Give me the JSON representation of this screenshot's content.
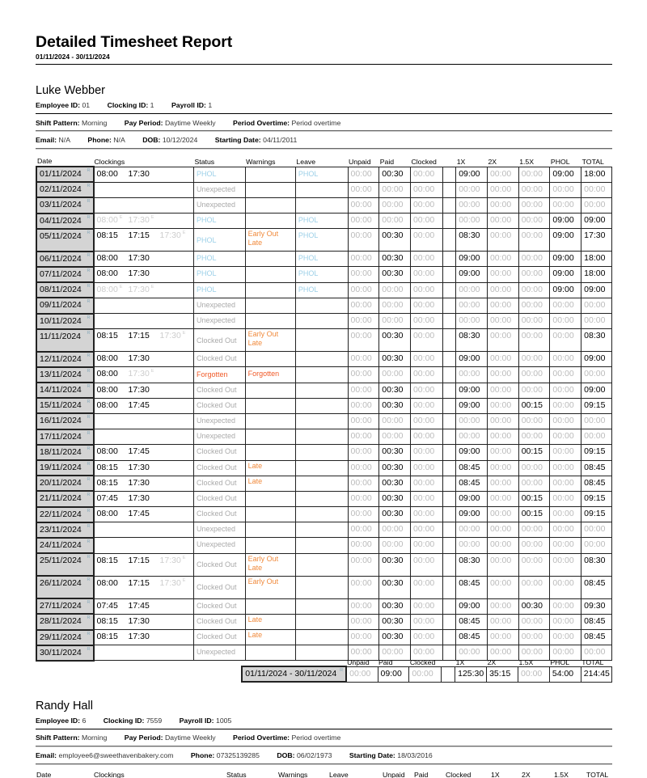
{
  "report": {
    "title": "Detailed Timesheet Report",
    "range": "01/11/2024 - 30/11/2024"
  },
  "columns": [
    "Date",
    "Clockings",
    "Status",
    "Warnings",
    "Leave",
    "Unpaid",
    "Paid",
    "Clocked",
    "",
    "1X",
    "2X",
    "1.5X",
    "PHOL",
    "TOTAL"
  ],
  "markers": {
    "rota": "R",
    "expected": "E"
  },
  "colors": {
    "phol": "#9cd0e8",
    "warning": "#f08a3c",
    "forgotten": "#f05a28",
    "muted": "#aaaaaa",
    "date_bg": "#d4d4d4"
  },
  "employees": [
    {
      "name": "Luke Webber",
      "employee_id_label": "Employee ID:",
      "employee_id": "01",
      "clocking_id_label": "Clocking ID:",
      "clocking_id": "1",
      "payroll_id_label": "Payroll ID:",
      "payroll_id": "1",
      "shift_pattern_label": "Shift Pattern:",
      "shift_pattern": "Morning",
      "pay_period_label": "Pay Period:",
      "pay_period": "Daytime Weekly",
      "period_overtime_label": "Period Overtime:",
      "period_overtime": "Period overtime",
      "email_label": "Email:",
      "email": "N/A",
      "phone_label": "Phone:",
      "phone": "N/A",
      "dob_label": "DOB:",
      "dob": "10/12/2024",
      "starting_date_label": "Starting Date:",
      "starting_date": "04/11/2011",
      "rows": [
        {
          "date": "01/11/2024",
          "clk": [
            [
              "08:00",
              0
            ],
            [
              "17:30",
              0
            ]
          ],
          "status": "PHOL",
          "st": "phol",
          "warn": [],
          "leave": "PHOL",
          "v": [
            "00:00",
            "00:30",
            "00:00",
            "09:00",
            "00:00",
            "00:00",
            "09:00",
            "18:00"
          ]
        },
        {
          "date": "02/11/2024",
          "clk": [],
          "status": "Unexpected",
          "st": "grey",
          "warn": [],
          "leave": "",
          "v": [
            "00:00",
            "00:00",
            "00:00",
            "00:00",
            "00:00",
            "00:00",
            "00:00",
            "00:00"
          ]
        },
        {
          "date": "03/11/2024",
          "clk": [],
          "status": "Unexpected",
          "st": "grey",
          "warn": [],
          "leave": "",
          "v": [
            "00:00",
            "00:00",
            "00:00",
            "00:00",
            "00:00",
            "00:00",
            "00:00",
            "00:00"
          ]
        },
        {
          "date": "04/11/2024",
          "clk": [
            [
              "08:00",
              1
            ],
            [
              "17:30",
              1
            ]
          ],
          "status": "PHOL",
          "st": "phol",
          "warn": [],
          "leave": "PHOL",
          "v": [
            "00:00",
            "00:00",
            "00:00",
            "00:00",
            "00:00",
            "00:00",
            "09:00",
            "09:00"
          ]
        },
        {
          "date": "05/11/2024",
          "clk": [
            [
              "08:15",
              0
            ],
            [
              "17:15",
              0
            ],
            [
              "17:30",
              1
            ]
          ],
          "status": "PHOL",
          "st": "phol",
          "warn": [
            "Early Out",
            "Late"
          ],
          "leave": "PHOL",
          "v": [
            "00:00",
            "00:30",
            "00:00",
            "08:30",
            "00:00",
            "00:00",
            "09:00",
            "17:30"
          ]
        },
        {
          "date": "06/11/2024",
          "clk": [
            [
              "08:00",
              0
            ],
            [
              "17:30",
              0
            ]
          ],
          "status": "PHOL",
          "st": "phol",
          "warn": [],
          "leave": "PHOL",
          "v": [
            "00:00",
            "00:30",
            "00:00",
            "09:00",
            "00:00",
            "00:00",
            "09:00",
            "18:00"
          ]
        },
        {
          "date": "07/11/2024",
          "clk": [
            [
              "08:00",
              0
            ],
            [
              "17:30",
              0
            ]
          ],
          "status": "PHOL",
          "st": "phol",
          "warn": [],
          "leave": "PHOL",
          "v": [
            "00:00",
            "00:30",
            "00:00",
            "09:00",
            "00:00",
            "00:00",
            "09:00",
            "18:00"
          ]
        },
        {
          "date": "08/11/2024",
          "clk": [
            [
              "08:00",
              1
            ],
            [
              "17:30",
              1
            ]
          ],
          "status": "PHOL",
          "st": "phol",
          "warn": [],
          "leave": "PHOL",
          "v": [
            "00:00",
            "00:00",
            "00:00",
            "00:00",
            "00:00",
            "00:00",
            "09:00",
            "09:00"
          ]
        },
        {
          "date": "09/11/2024",
          "clk": [],
          "status": "Unexpected",
          "st": "grey",
          "warn": [],
          "leave": "",
          "v": [
            "00:00",
            "00:00",
            "00:00",
            "00:00",
            "00:00",
            "00:00",
            "00:00",
            "00:00"
          ]
        },
        {
          "date": "10/11/2024",
          "clk": [],
          "status": "Unexpected",
          "st": "grey",
          "warn": [],
          "leave": "",
          "v": [
            "00:00",
            "00:00",
            "00:00",
            "00:00",
            "00:00",
            "00:00",
            "00:00",
            "00:00"
          ]
        },
        {
          "date": "11/11/2024",
          "clk": [
            [
              "08:15",
              0
            ],
            [
              "17:15",
              0
            ],
            [
              "17:30",
              1
            ]
          ],
          "status": "Clocked Out",
          "st": "grey",
          "warn": [
            "Early Out",
            "Late"
          ],
          "leave": "",
          "v": [
            "00:00",
            "00:30",
            "00:00",
            "08:30",
            "00:00",
            "00:00",
            "00:00",
            "08:30"
          ]
        },
        {
          "date": "12/11/2024",
          "clk": [
            [
              "08:00",
              0
            ],
            [
              "17:30",
              0
            ]
          ],
          "status": "Clocked Out",
          "st": "grey",
          "warn": [],
          "leave": "",
          "v": [
            "00:00",
            "00:30",
            "00:00",
            "09:00",
            "00:00",
            "00:00",
            "00:00",
            "09:00"
          ]
        },
        {
          "date": "13/11/2024",
          "clk": [
            [
              "08:00",
              0
            ],
            [
              "17:30",
              1
            ]
          ],
          "status": "Forgotten",
          "st": "forgot",
          "warn": [
            "Forgotten"
          ],
          "leave": "",
          "v": [
            "00:00",
            "00:00",
            "00:00",
            "00:00",
            "00:00",
            "00:00",
            "00:00",
            "00:00"
          ]
        },
        {
          "date": "14/11/2024",
          "clk": [
            [
              "08:00",
              0
            ],
            [
              "17:30",
              0
            ]
          ],
          "status": "Clocked Out",
          "st": "grey",
          "warn": [],
          "leave": "",
          "v": [
            "00:00",
            "00:30",
            "00:00",
            "09:00",
            "00:00",
            "00:00",
            "00:00",
            "09:00"
          ]
        },
        {
          "date": "15/11/2024",
          "clk": [
            [
              "08:00",
              0
            ],
            [
              "17:45",
              0
            ]
          ],
          "status": "Clocked Out",
          "st": "grey",
          "warn": [],
          "leave": "",
          "v": [
            "00:00",
            "00:30",
            "00:00",
            "09:00",
            "00:00",
            "00:15",
            "00:00",
            "09:15"
          ]
        },
        {
          "date": "16/11/2024",
          "clk": [],
          "status": "Unexpected",
          "st": "grey",
          "warn": [],
          "leave": "",
          "v": [
            "00:00",
            "00:00",
            "00:00",
            "00:00",
            "00:00",
            "00:00",
            "00:00",
            "00:00"
          ]
        },
        {
          "date": "17/11/2024",
          "clk": [],
          "status": "Unexpected",
          "st": "grey",
          "warn": [],
          "leave": "",
          "v": [
            "00:00",
            "00:00",
            "00:00",
            "00:00",
            "00:00",
            "00:00",
            "00:00",
            "00:00"
          ]
        },
        {
          "date": "18/11/2024",
          "clk": [
            [
              "08:00",
              0
            ],
            [
              "17:45",
              0
            ]
          ],
          "status": "Clocked Out",
          "st": "grey",
          "warn": [],
          "leave": "",
          "v": [
            "00:00",
            "00:30",
            "00:00",
            "09:00",
            "00:00",
            "00:15",
            "00:00",
            "09:15"
          ]
        },
        {
          "date": "19/11/2024",
          "clk": [
            [
              "08:15",
              0
            ],
            [
              "17:30",
              0
            ]
          ],
          "status": "Clocked Out",
          "st": "grey",
          "warn": [
            "Late"
          ],
          "leave": "",
          "v": [
            "00:00",
            "00:30",
            "00:00",
            "08:45",
            "00:00",
            "00:00",
            "00:00",
            "08:45"
          ]
        },
        {
          "date": "20/11/2024",
          "clk": [
            [
              "08:15",
              0
            ],
            [
              "17:30",
              0
            ]
          ],
          "status": "Clocked Out",
          "st": "grey",
          "warn": [
            "Late"
          ],
          "leave": "",
          "v": [
            "00:00",
            "00:30",
            "00:00",
            "08:45",
            "00:00",
            "00:00",
            "00:00",
            "08:45"
          ]
        },
        {
          "date": "21/11/2024",
          "clk": [
            [
              "07:45",
              0
            ],
            [
              "17:30",
              0
            ]
          ],
          "status": "Clocked Out",
          "st": "grey",
          "warn": [],
          "leave": "",
          "v": [
            "00:00",
            "00:30",
            "00:00",
            "09:00",
            "00:00",
            "00:15",
            "00:00",
            "09:15"
          ]
        },
        {
          "date": "22/11/2024",
          "clk": [
            [
              "08:00",
              0
            ],
            [
              "17:45",
              0
            ]
          ],
          "status": "Clocked Out",
          "st": "grey",
          "warn": [],
          "leave": "",
          "v": [
            "00:00",
            "00:30",
            "00:00",
            "09:00",
            "00:00",
            "00:15",
            "00:00",
            "09:15"
          ]
        },
        {
          "date": "23/11/2024",
          "clk": [],
          "status": "Unexpected",
          "st": "grey",
          "warn": [],
          "leave": "",
          "v": [
            "00:00",
            "00:00",
            "00:00",
            "00:00",
            "00:00",
            "00:00",
            "00:00",
            "00:00"
          ]
        },
        {
          "date": "24/11/2024",
          "clk": [],
          "status": "Unexpected",
          "st": "grey",
          "warn": [],
          "leave": "",
          "v": [
            "00:00",
            "00:00",
            "00:00",
            "00:00",
            "00:00",
            "00:00",
            "00:00",
            "00:00"
          ]
        },
        {
          "date": "25/11/2024",
          "clk": [
            [
              "08:15",
              0
            ],
            [
              "17:15",
              0
            ],
            [
              "17:30",
              1
            ]
          ],
          "status": "Clocked Out",
          "st": "grey",
          "warn": [
            "Early Out",
            "Late"
          ],
          "leave": "",
          "v": [
            "00:00",
            "00:30",
            "00:00",
            "08:30",
            "00:00",
            "00:00",
            "00:00",
            "08:30"
          ]
        },
        {
          "date": "26/11/2024",
          "clk": [
            [
              "08:00",
              0
            ],
            [
              "17:15",
              0
            ],
            [
              "17:30",
              1
            ]
          ],
          "status": "Clocked Out",
          "st": "grey",
          "warn": [
            "Early Out"
          ],
          "leave": "",
          "v": [
            "00:00",
            "00:30",
            "00:00",
            "08:45",
            "00:00",
            "00:00",
            "00:00",
            "08:45"
          ]
        },
        {
          "date": "27/11/2024",
          "clk": [
            [
              "07:45",
              0
            ],
            [
              "17:45",
              0
            ]
          ],
          "status": "Clocked Out",
          "st": "grey",
          "warn": [],
          "leave": "",
          "v": [
            "00:00",
            "00:30",
            "00:00",
            "09:00",
            "00:00",
            "00:30",
            "00:00",
            "09:30"
          ]
        },
        {
          "date": "28/11/2024",
          "clk": [
            [
              "08:15",
              0
            ],
            [
              "17:30",
              0
            ]
          ],
          "status": "Clocked Out",
          "st": "grey",
          "warn": [
            "Late"
          ],
          "leave": "",
          "v": [
            "00:00",
            "00:30",
            "00:00",
            "08:45",
            "00:00",
            "00:00",
            "00:00",
            "08:45"
          ]
        },
        {
          "date": "29/11/2024",
          "clk": [
            [
              "08:15",
              0
            ],
            [
              "17:30",
              0
            ]
          ],
          "status": "Clocked Out",
          "st": "grey",
          "warn": [
            "Late"
          ],
          "leave": "",
          "v": [
            "00:00",
            "00:30",
            "00:00",
            "08:45",
            "00:00",
            "00:00",
            "00:00",
            "08:45"
          ]
        },
        {
          "date": "30/11/2024",
          "clk": [],
          "status": "Unexpected",
          "st": "grey",
          "warn": [],
          "leave": "",
          "v": [
            "00:00",
            "00:00",
            "00:00",
            "00:00",
            "00:00",
            "00:00",
            "00:00",
            "00:00"
          ]
        }
      ],
      "totals": {
        "range": "01/11/2024 - 30/11/2024",
        "headers": [
          "Unpaid",
          "Paid",
          "Clocked",
          "",
          "1X",
          "2X",
          "1.5X",
          "PHOL",
          "TOTAL"
        ],
        "values": [
          "00:00",
          "09:00",
          "00:00",
          "125:30",
          "35:15",
          "00:00",
          "54:00",
          "214:45"
        ]
      }
    },
    {
      "name": "Randy Hall",
      "employee_id_label": "Employee ID:",
      "employee_id": "6",
      "clocking_id_label": "Clocking ID:",
      "clocking_id": "7559",
      "payroll_id_label": "Payroll ID:",
      "payroll_id": "1005",
      "shift_pattern_label": "Shift Pattern:",
      "shift_pattern": "Morning",
      "pay_period_label": "Pay Period:",
      "pay_period": "Daytime Weekly",
      "period_overtime_label": "Period Overtime:",
      "period_overtime": "Period overtime",
      "email_label": "Email:",
      "email": "employee6@sweethavenbakery.com",
      "phone_label": "Phone:",
      "phone": "07325139285",
      "dob_label": "DOB:",
      "dob": "06/02/1973",
      "starting_date_label": "Starting Date:",
      "starting_date": "18/03/2016",
      "columns": [
        "Date",
        "Clockings",
        "Status",
        "Warnings",
        "Leave",
        "Unpaid",
        "Paid",
        "Clocked",
        "1X",
        "2X",
        "1.5X",
        "TOTAL"
      ]
    }
  ]
}
